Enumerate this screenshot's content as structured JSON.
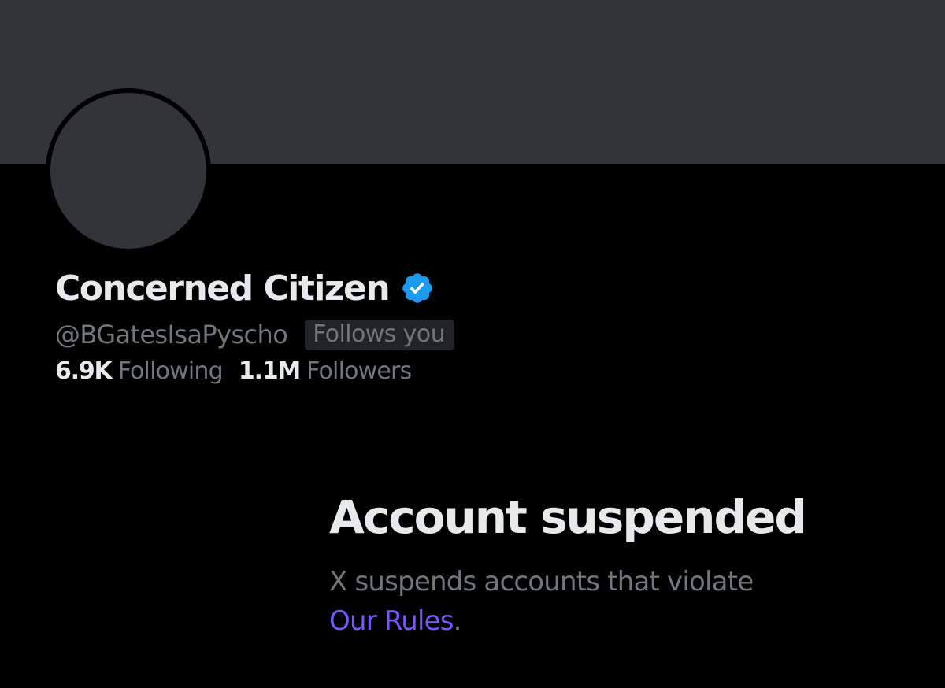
{
  "profile": {
    "display_name": "Concerned Citizen",
    "verified_icon": "verified-badge-icon",
    "handle": "@BGatesIsaPyscho",
    "follows_you_label": "Follows you",
    "following_count": "6.9K",
    "following_label": "Following",
    "followers_count": "1.1M",
    "followers_label": "Followers"
  },
  "suspension": {
    "title": "Account suspended",
    "message_prefix": "X suspends accounts that violate",
    "rules_link_label": "Our Rules",
    "message_suffix": "."
  },
  "colors": {
    "background": "#000000",
    "banner": "#333438",
    "primary_text": "#e7e9ea",
    "secondary_text": "#71767b",
    "verified_blue": "#1d9bf0",
    "link_purple": "#7856ff"
  }
}
